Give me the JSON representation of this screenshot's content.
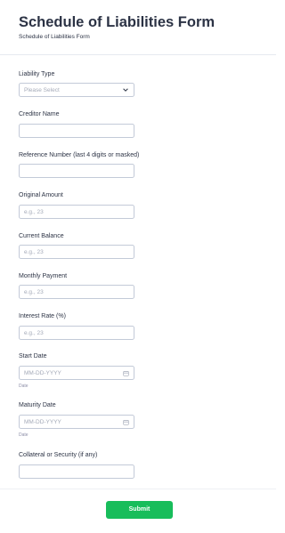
{
  "form": {
    "title": "Schedule of Liabilities Form",
    "subtitle": "Schedule of Liabilities Form"
  },
  "fields": {
    "liability_type": {
      "label": "Liability Type",
      "placeholder": "Please Select"
    },
    "creditor_name": {
      "label": "Creditor Name",
      "value": ""
    },
    "reference_number": {
      "label": "Reference Number (last 4 digits or masked)",
      "value": ""
    },
    "original_amount": {
      "label": "Original Amount",
      "placeholder": "e.g., 23"
    },
    "current_balance": {
      "label": "Current Balance",
      "placeholder": "e.g., 23"
    },
    "monthly_payment": {
      "label": "Monthly Payment",
      "placeholder": "e.g., 23"
    },
    "interest_rate": {
      "label": "Interest Rate (%)",
      "placeholder": "e.g., 23"
    },
    "start_date": {
      "label": "Start Date",
      "placeholder": "MM-DD-YYYY",
      "sublabel": "Date"
    },
    "maturity_date": {
      "label": "Maturity Date",
      "placeholder": "MM-DD-YYYY",
      "sublabel": "Date"
    },
    "collateral": {
      "label": "Collateral or Security (if any)",
      "value": ""
    }
  },
  "actions": {
    "submit_label": "Submit"
  },
  "colors": {
    "submit": "#18bd5b",
    "text": "#2c3345",
    "border": "#c3cad8",
    "placeholder": "#a4aab8"
  },
  "icons": {
    "select": "chevron-down-icon",
    "date": "calendar-icon"
  }
}
